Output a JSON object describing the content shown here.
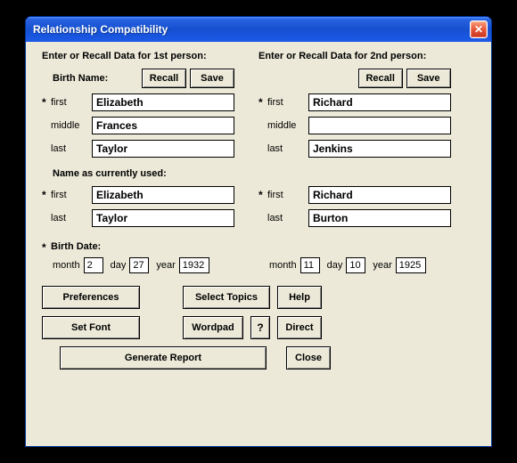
{
  "window": {
    "title": "Relationship Compatibility"
  },
  "headers": {
    "p1": "Enter or Recall Data for 1st person:",
    "p2": "Enter or Recall Data for 2nd person:"
  },
  "labels": {
    "birthName": "Birth Name:",
    "recall": "Recall",
    "save": "Save",
    "first": "first",
    "middle": "middle",
    "last": "last",
    "currentName": "Name as currently used:",
    "birthDate": "Birth Date:",
    "month": "month",
    "day": "day",
    "year": "year"
  },
  "person1": {
    "birth": {
      "first": "Elizabeth",
      "middle": "Frances",
      "last": "Taylor"
    },
    "current": {
      "first": "Elizabeth",
      "last": "Taylor"
    },
    "date": {
      "month": "2",
      "day": "27",
      "year": "1932"
    }
  },
  "person2": {
    "birth": {
      "first": "Richard",
      "middle": "",
      "last": "Jenkins"
    },
    "current": {
      "first": "Richard",
      "last": "Burton"
    },
    "date": {
      "month": "11",
      "day": "10",
      "year": "1925"
    }
  },
  "buttons": {
    "preferences": "Preferences",
    "selectTopics": "Select Topics",
    "help": "Help",
    "setFont": "Set Font",
    "wordpad": "Wordpad",
    "question": "?",
    "direct": "Direct",
    "generate": "Generate Report",
    "close": "Close"
  }
}
